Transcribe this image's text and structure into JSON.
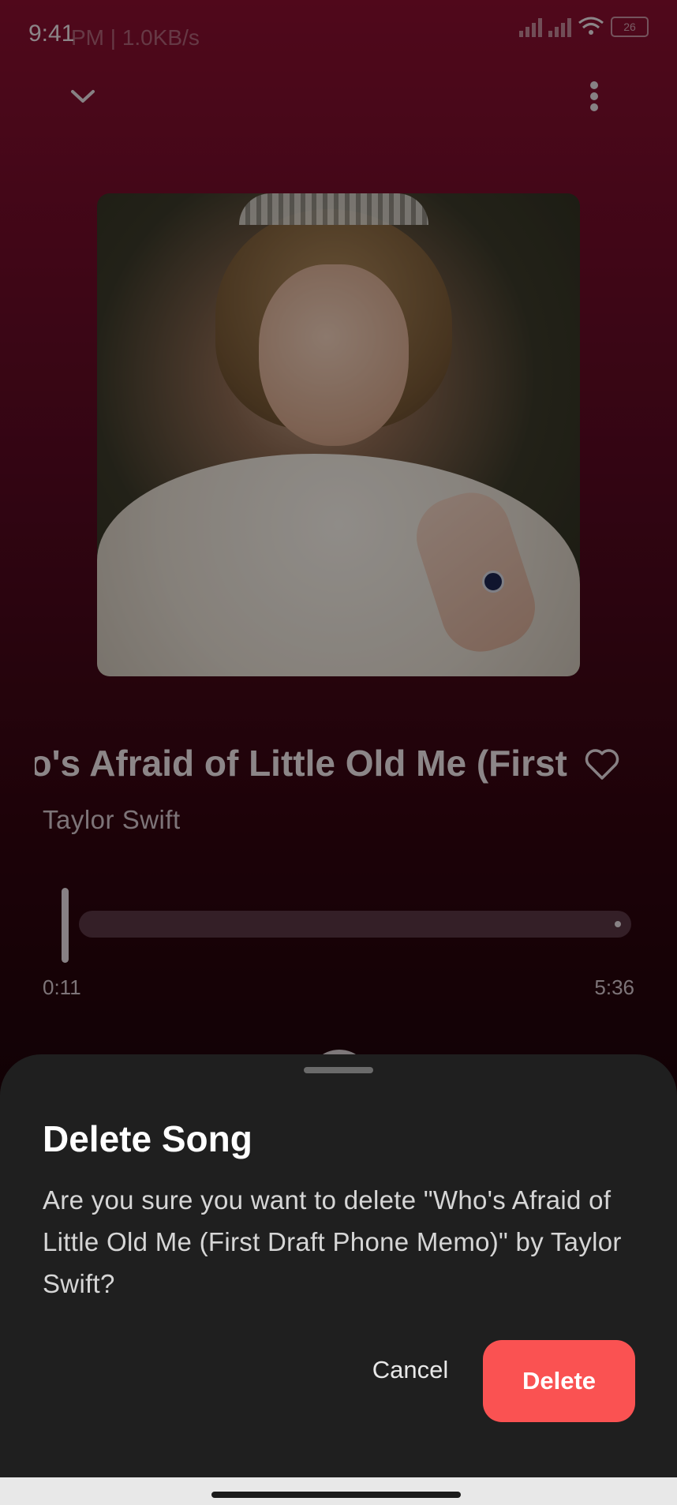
{
  "status_bar": {
    "time": "9:41",
    "ghost_time": "PM | 1.0KB/s",
    "battery": "26"
  },
  "player": {
    "collapse_icon": "chevron-down-icon",
    "menu_icon": "more-vert-icon",
    "song_title": "Who's Afraid of Little Old Me (First Draft Phone Memo)",
    "artist": "Taylor Swift",
    "current_time": "0:11",
    "total_time": "5:36",
    "progress_fraction": 0.033,
    "favorite_icon": "heart-outline-icon"
  },
  "dialog": {
    "title": "Delete Song",
    "message": "Are you sure you want to delete \"Who's Afraid of Little Old Me (First Draft Phone Memo)\" by Taylor Swift?",
    "cancel_label": "Cancel",
    "delete_label": "Delete"
  },
  "colors": {
    "accent_delete": "#fa5252",
    "sheet_bg": "#1f1f1f",
    "player_gradient_top": "#8a0f30"
  }
}
